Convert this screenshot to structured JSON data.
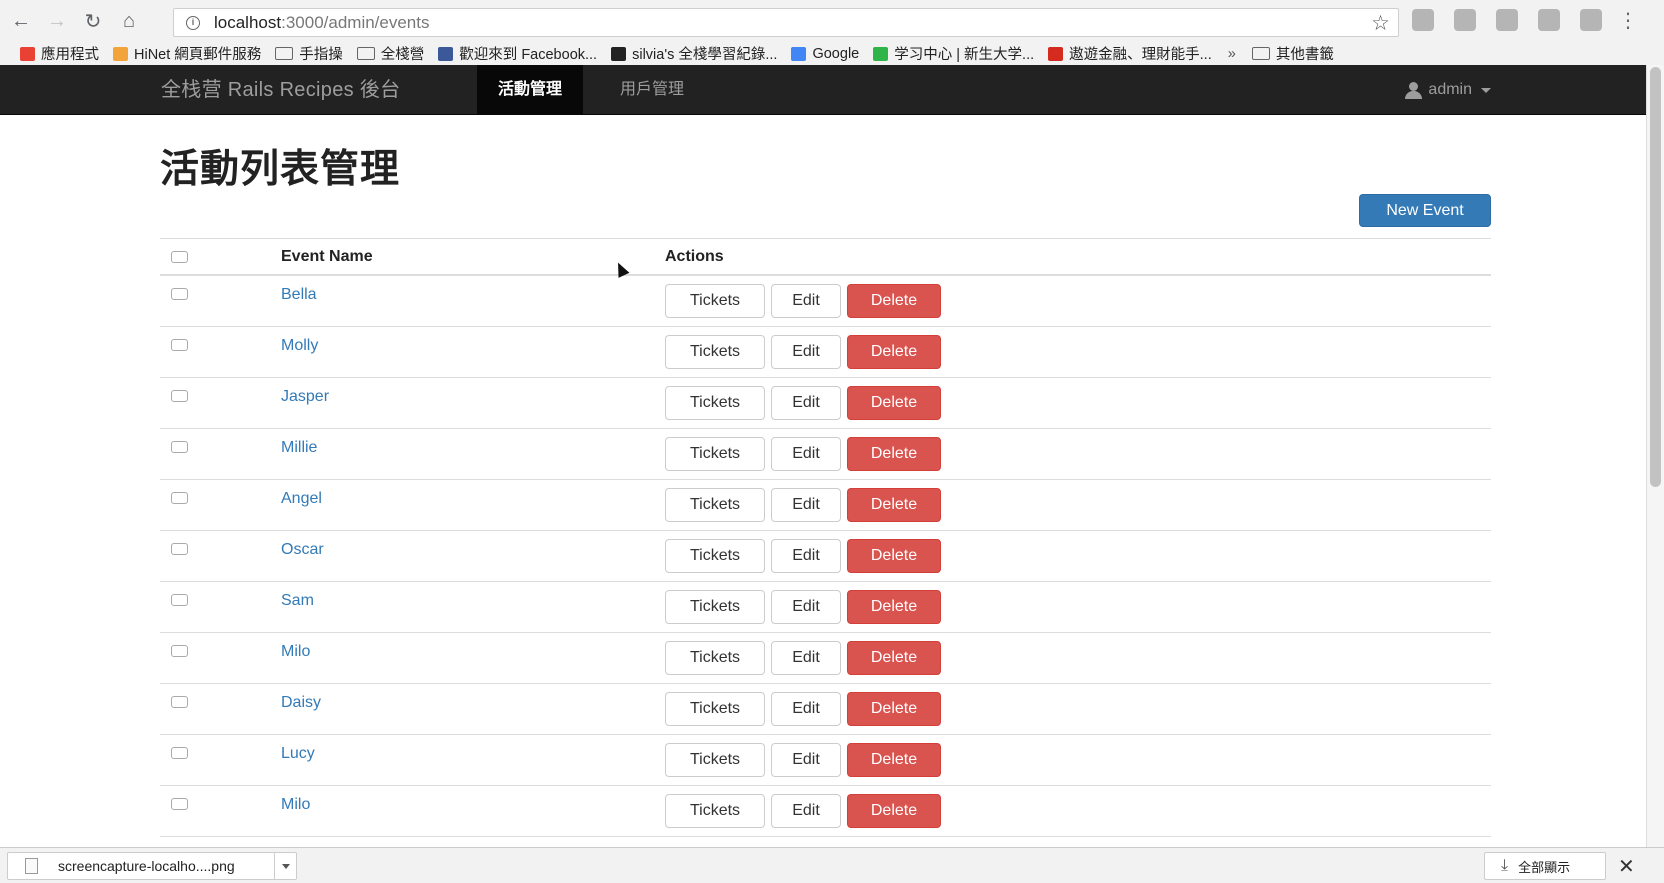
{
  "browser": {
    "url_host": "localhost",
    "url_rest": ":3000/admin/events",
    "bookmarks": [
      {
        "label": "應用程式",
        "color": "#e94235"
      },
      {
        "label": "HiNet 網頁郵件服務",
        "color": "#f2a33a"
      },
      {
        "label": "手指操",
        "color": "folder"
      },
      {
        "label": "全棧營",
        "color": "folder"
      },
      {
        "label": "歡迎來到 Facebook...",
        "color": "#3b5998"
      },
      {
        "label": "silvia's 全棧學習紀錄...",
        "color": "#222222"
      },
      {
        "label": "Google",
        "color": "#4285f4"
      },
      {
        "label": "学习中心 | 新生大学...",
        "color": "#2fb44a"
      },
      {
        "label": "遨遊金融、理財能手...",
        "color": "#d52b1e"
      }
    ],
    "bookmarks_more": "»",
    "bookmarks_other": "其他書籤"
  },
  "navbar": {
    "brand": "全栈营 Rails Recipes 後台",
    "tabs": [
      {
        "label": "活動管理",
        "active": true
      },
      {
        "label": "用戶管理",
        "active": false
      }
    ],
    "user": "admin"
  },
  "page": {
    "title": "活動列表管理",
    "new_button": "New Event",
    "columns": {
      "name": "Event Name",
      "actions": "Actions"
    },
    "action_labels": {
      "tickets": "Tickets",
      "edit": "Edit",
      "delete": "Delete"
    },
    "events": [
      "Bella",
      "Molly",
      "Jasper",
      "Millie",
      "Angel",
      "Oscar",
      "Sam",
      "Milo",
      "Daisy",
      "Lucy",
      "Milo"
    ]
  },
  "downloads": {
    "file": "screencapture-localho....png",
    "show_all": "全部顯示"
  },
  "colors": {
    "primary": "#337ab7",
    "danger": "#d9534f",
    "navbar": "#222222"
  }
}
